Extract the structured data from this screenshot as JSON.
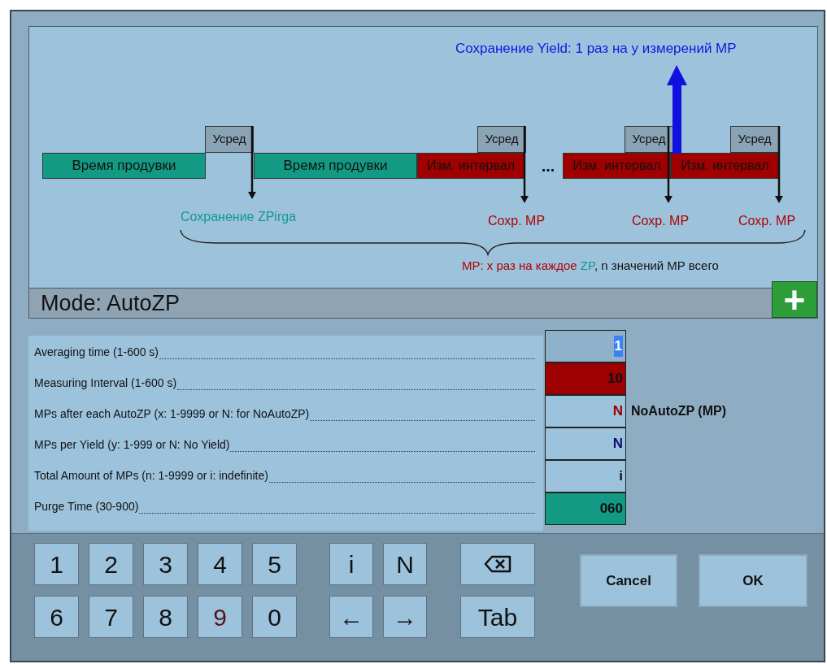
{
  "diagram": {
    "yield_note": "Сохранение Yield: 1 раз на y измерений MP",
    "segments": [
      {
        "kind": "purge",
        "label": "Время продувки"
      },
      {
        "kind": "purge",
        "label": "Время продувки"
      },
      {
        "kind": "measure",
        "label": "Изм. интервал"
      },
      {
        "kind": "gap",
        "label": "..."
      },
      {
        "kind": "measure",
        "label": "Изм. интервал"
      },
      {
        "kind": "measure",
        "label": "Изм. интервал"
      }
    ],
    "averaging": [
      "Усред",
      "Усред",
      "Усред",
      "Усред"
    ],
    "save_markers": [
      {
        "kind": "zero",
        "label": "Сохранение ZPirga"
      },
      {
        "kind": "mp",
        "label": "Сохр. MP"
      },
      {
        "kind": "mp",
        "label": "Сохр. MP"
      },
      {
        "kind": "mp",
        "label": "Сохр. MP"
      }
    ],
    "caption": [
      {
        "text": "MP: x раз на каждое ",
        "color": "#b00000"
      },
      {
        "text": "ZP",
        "color": "#129a88"
      },
      {
        "text": ", n значений MP всего",
        "color": "#111111"
      }
    ]
  },
  "mode": {
    "label": "Mode: AutoZP",
    "add_button": "+"
  },
  "fields": [
    {
      "label": "Averaging time (1-600 s)",
      "value": "1",
      "color": "#8fb1c9",
      "kind": "highlighted",
      "selected": true
    },
    {
      "label": "Measuring Interval (1-600 s)",
      "value": "10",
      "color": "#9c0000",
      "kind": "plain",
      "selected": false
    },
    {
      "label": "MPs after each AutoZP (x: 1-9999 or N: for NoAutoZP)",
      "value": "N",
      "color": "#9dc3dc",
      "kind": "warning",
      "selected": false,
      "note": "NoAutoZP (MP)"
    },
    {
      "label": "MPs per Yield (y: 1-999 or N: No Yield)",
      "value": "N",
      "color": "#9dc3dc",
      "kind": "info",
      "selected": false
    },
    {
      "label": "Total Amount of MPs  (n: 1-9999 or i: indefinite)",
      "value": "i",
      "color": "#9dc3dc",
      "kind": "plain",
      "selected": false
    },
    {
      "label": "Purge Time (30-900)",
      "value": "060",
      "color": "#139a84",
      "kind": "plain",
      "selected": false
    }
  ],
  "keypad": {
    "digits": [
      {
        "label": "1",
        "kind": "plain"
      },
      {
        "label": "2",
        "kind": "plain"
      },
      {
        "label": "3",
        "kind": "plain"
      },
      {
        "label": "4",
        "kind": "plain"
      },
      {
        "label": "5",
        "kind": "plain"
      },
      {
        "label": "6",
        "kind": "plain"
      },
      {
        "label": "7",
        "kind": "plain"
      },
      {
        "label": "8",
        "kind": "plain"
      },
      {
        "label": "9",
        "kind": "accent"
      },
      {
        "label": "0",
        "kind": "plain"
      }
    ],
    "special": [
      {
        "kind": "text",
        "label": "i"
      },
      {
        "kind": "text",
        "label": "N"
      },
      {
        "kind": "text",
        "label": "←"
      },
      {
        "kind": "text",
        "label": "→"
      }
    ],
    "edit": [
      {
        "kind": "backspace"
      },
      {
        "kind": "text",
        "label": "Tab"
      }
    ]
  },
  "buttons": [
    "Cancel",
    "OK"
  ]
}
